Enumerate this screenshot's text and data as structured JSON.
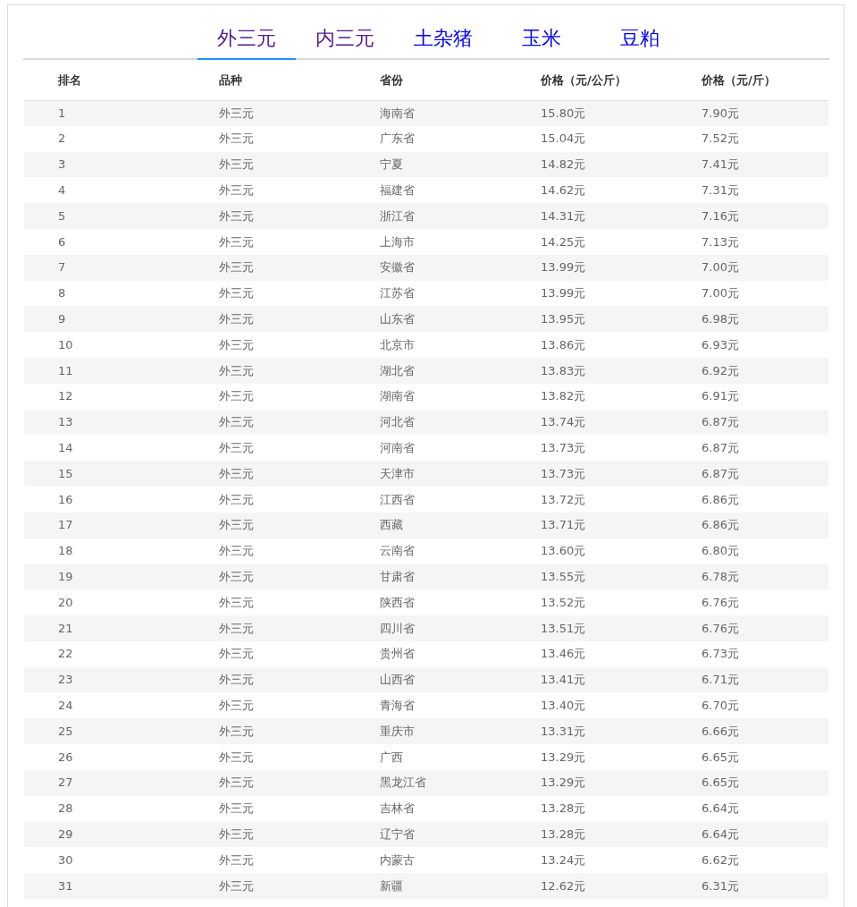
{
  "tabs": [
    {
      "label": "外三元",
      "selected": true,
      "visited": true
    },
    {
      "label": "内三元",
      "selected": false,
      "visited": true
    },
    {
      "label": "土杂猪",
      "selected": false,
      "visited": false
    },
    {
      "label": "玉米",
      "selected": false,
      "visited": false
    },
    {
      "label": "豆粕",
      "selected": false,
      "visited": false
    }
  ],
  "table": {
    "columns": [
      "排名",
      "品种",
      "省份",
      "价格（元/公斤）",
      "价格（元/斤）"
    ],
    "rows": [
      [
        "1",
        "外三元",
        "海南省",
        "15.80元",
        "7.90元"
      ],
      [
        "2",
        "外三元",
        "广东省",
        "15.04元",
        "7.52元"
      ],
      [
        "3",
        "外三元",
        "宁夏",
        "14.82元",
        "7.41元"
      ],
      [
        "4",
        "外三元",
        "福建省",
        "14.62元",
        "7.31元"
      ],
      [
        "5",
        "外三元",
        "浙江省",
        "14.31元",
        "7.16元"
      ],
      [
        "6",
        "外三元",
        "上海市",
        "14.25元",
        "7.13元"
      ],
      [
        "7",
        "外三元",
        "安徽省",
        "13.99元",
        "7.00元"
      ],
      [
        "8",
        "外三元",
        "江苏省",
        "13.99元",
        "7.00元"
      ],
      [
        "9",
        "外三元",
        "山东省",
        "13.95元",
        "6.98元"
      ],
      [
        "10",
        "外三元",
        "北京市",
        "13.86元",
        "6.93元"
      ],
      [
        "11",
        "外三元",
        "湖北省",
        "13.83元",
        "6.92元"
      ],
      [
        "12",
        "外三元",
        "湖南省",
        "13.82元",
        "6.91元"
      ],
      [
        "13",
        "外三元",
        "河北省",
        "13.74元",
        "6.87元"
      ],
      [
        "14",
        "外三元",
        "河南省",
        "13.73元",
        "6.87元"
      ],
      [
        "15",
        "外三元",
        "天津市",
        "13.73元",
        "6.87元"
      ],
      [
        "16",
        "外三元",
        "江西省",
        "13.72元",
        "6.86元"
      ],
      [
        "17",
        "外三元",
        "西藏",
        "13.71元",
        "6.86元"
      ],
      [
        "18",
        "外三元",
        "云南省",
        "13.60元",
        "6.80元"
      ],
      [
        "19",
        "外三元",
        "甘肃省",
        "13.55元",
        "6.78元"
      ],
      [
        "20",
        "外三元",
        "陕西省",
        "13.52元",
        "6.76元"
      ],
      [
        "21",
        "外三元",
        "四川省",
        "13.51元",
        "6.76元"
      ],
      [
        "22",
        "外三元",
        "贵州省",
        "13.46元",
        "6.73元"
      ],
      [
        "23",
        "外三元",
        "山西省",
        "13.41元",
        "6.71元"
      ],
      [
        "24",
        "外三元",
        "青海省",
        "13.40元",
        "6.70元"
      ],
      [
        "25",
        "外三元",
        "重庆市",
        "13.31元",
        "6.66元"
      ],
      [
        "26",
        "外三元",
        "广西",
        "13.29元",
        "6.65元"
      ],
      [
        "27",
        "外三元",
        "黑龙江省",
        "13.29元",
        "6.65元"
      ],
      [
        "28",
        "外三元",
        "吉林省",
        "13.28元",
        "6.64元"
      ],
      [
        "29",
        "外三元",
        "辽宁省",
        "13.28元",
        "6.64元"
      ],
      [
        "30",
        "外三元",
        "内蒙古",
        "13.24元",
        "6.62元"
      ],
      [
        "31",
        "外三元",
        "新疆",
        "12.62元",
        "6.31元"
      ]
    ]
  }
}
